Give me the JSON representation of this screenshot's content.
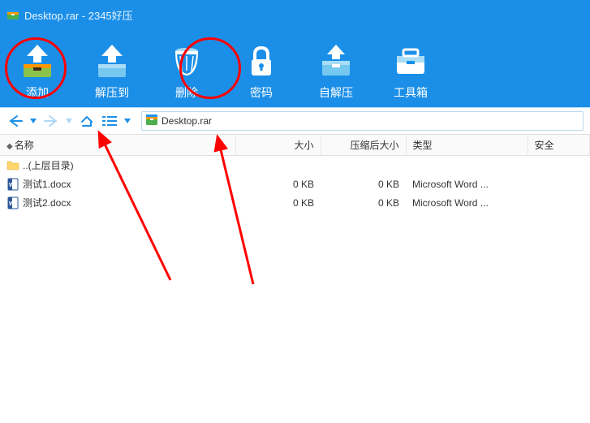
{
  "titlebar": {
    "title": "Desktop.rar - 2345好压"
  },
  "toolbar": {
    "add": "添加",
    "extract_to": "解压到",
    "delete": "删除",
    "password": "密码",
    "sfx": "自解压",
    "toolbox": "工具箱"
  },
  "breadcrumb": {
    "current": "Desktop.rar"
  },
  "columns": {
    "name": "名称",
    "size": "大小",
    "packed": "压缩后大小",
    "type": "类型",
    "security": "安全"
  },
  "rows": [
    {
      "name": "..(上层目录)",
      "size": "",
      "packed": "",
      "type": "",
      "kind": "folder"
    },
    {
      "name": "测试1.docx",
      "size": "0 KB",
      "packed": "0 KB",
      "type": "Microsoft Word ...",
      "kind": "docx"
    },
    {
      "name": "测试2.docx",
      "size": "0 KB",
      "packed": "0 KB",
      "type": "Microsoft Word ...",
      "kind": "docx"
    }
  ]
}
